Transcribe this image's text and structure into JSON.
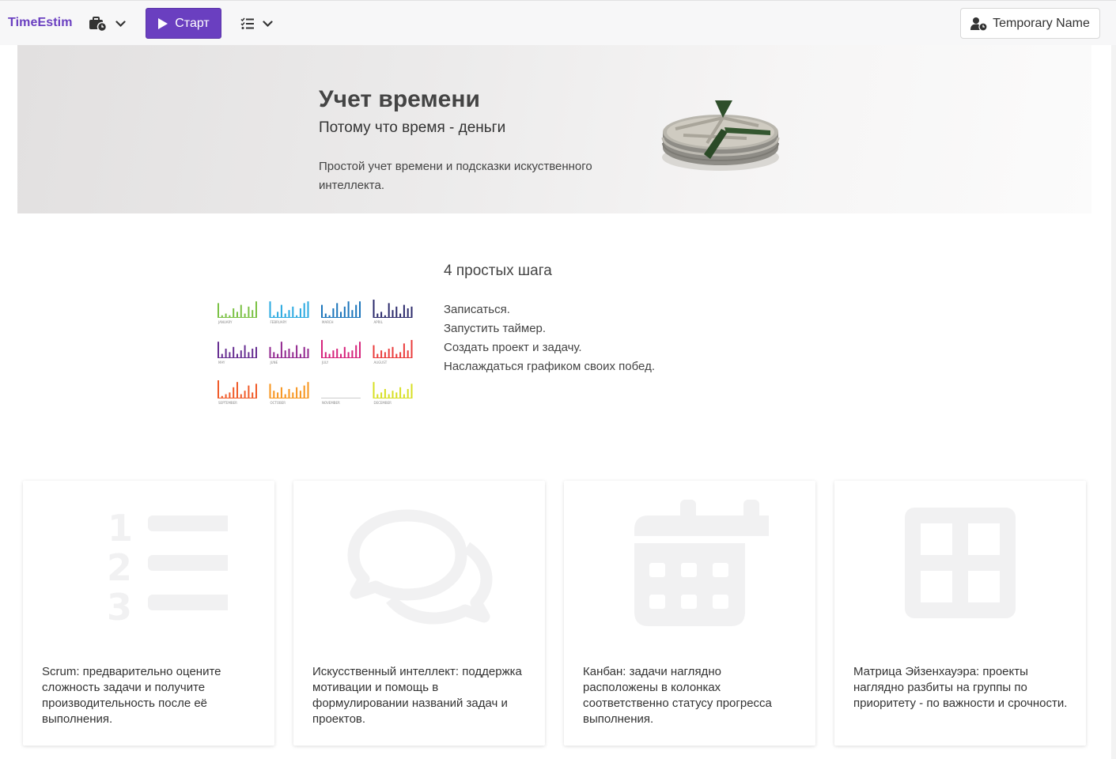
{
  "navbar": {
    "brand": "TimeEstim",
    "start_label": "Старт",
    "user_label": "Temporary Name",
    "projects_icon": "briefcase-clock-icon",
    "tasks_icon": "task-list-icon"
  },
  "hero": {
    "title": "Учет времени",
    "subtitle": "Потому что время - деньги",
    "description": "Простой учет времени и подсказки искуственного интеллекта.",
    "image_icon": "money-pie-chart-image"
  },
  "steps": {
    "title": "4 простых шага",
    "items": [
      "Записаться.",
      "Запустить таймер.",
      "Создать проект и задачу.",
      "Наслаждаться графиком своих побед."
    ]
  },
  "mini_charts": [
    {
      "label": "JANUARY",
      "color": "#7ac143",
      "values": [
        0.8,
        0.1,
        0.2,
        0.1,
        0.5,
        0.3,
        0.7,
        0.2,
        0.6,
        0.4,
        0.9
      ]
    },
    {
      "label": "FEBRUARY",
      "color": "#29a9e0",
      "values": [
        0.9,
        0.1,
        0.3,
        0.7,
        0.2,
        0.4,
        0.6,
        0.1,
        0.5,
        0.8,
        0.9
      ]
    },
    {
      "label": "MARCH",
      "color": "#1b75bb",
      "values": [
        0.7,
        0.2,
        0.1,
        0.5,
        0.8,
        0.3,
        0.6,
        0.9,
        0.4,
        0.7,
        0.9
      ]
    },
    {
      "label": "APRIL",
      "color": "#2b2a6b",
      "values": [
        1.0,
        0.2,
        0.3,
        0.1,
        0.8,
        0.4,
        0.6,
        0.2,
        0.7,
        0.5,
        0.6
      ]
    },
    {
      "label": "MAY",
      "color": "#662d91",
      "values": [
        0.9,
        0.2,
        0.5,
        0.3,
        0.6,
        0.2,
        0.4,
        0.7,
        0.3,
        0.5,
        0.6
      ]
    },
    {
      "label": "JUNE",
      "color": "#92278f",
      "values": [
        0.6,
        0.3,
        0.2,
        0.9,
        0.4,
        0.5,
        0.3,
        0.7,
        0.2,
        0.6,
        0.5
      ]
    },
    {
      "label": "JULY",
      "color": "#d6247c",
      "values": [
        1.0,
        0.3,
        0.2,
        0.4,
        0.5,
        0.2,
        0.6,
        0.3,
        0.4,
        0.7,
        0.9
      ]
    },
    {
      "label": "AUGUST",
      "color": "#ea3c3c",
      "values": [
        0.7,
        0.2,
        0.4,
        0.3,
        0.5,
        0.6,
        0.2,
        0.3,
        0.8,
        0.4,
        1.0
      ]
    },
    {
      "label": "SEPTEMBER",
      "color": "#f05a28",
      "values": [
        1.0,
        0.1,
        0.2,
        0.3,
        0.6,
        0.9,
        0.2,
        0.4,
        0.7,
        0.3,
        0.8
      ]
    },
    {
      "label": "OCTOBER",
      "color": "#f7941d",
      "values": [
        0.8,
        0.4,
        0.3,
        0.6,
        0.2,
        0.5,
        0.3,
        0.6,
        0.4,
        0.7,
        0.9
      ]
    },
    {
      "label": "NOVEMBER",
      "color": "#cccccc",
      "values": []
    },
    {
      "label": "DECEMBER",
      "color": "#d7df23",
      "values": [
        0.9,
        0.2,
        0.3,
        0.5,
        0.2,
        0.4,
        0.3,
        0.6,
        0.2,
        0.5,
        0.8
      ]
    }
  ],
  "cards": [
    {
      "icon": "numbered-list-icon",
      "text": "Scrum: предварительно оцените сложность задачи и получите производительность после её выполнения."
    },
    {
      "icon": "chat-bubbles-icon",
      "text": "Искусственный интеллект: поддержка мотивации и помощь в формулировании названий задач и проектов."
    },
    {
      "icon": "calendar-icon",
      "text": "Канбан: задачи наглядно расположены в колонках соответственно статусу прогресса выполнения."
    },
    {
      "icon": "grid-matrix-icon",
      "text": "Матрица Эйзенхауэра: проекты наглядно разбиты на группы по приоритету - по важности и срочности."
    }
  ],
  "colors": {
    "brand": "#6a3fc0",
    "icon_gray": "#f1f1f2"
  }
}
